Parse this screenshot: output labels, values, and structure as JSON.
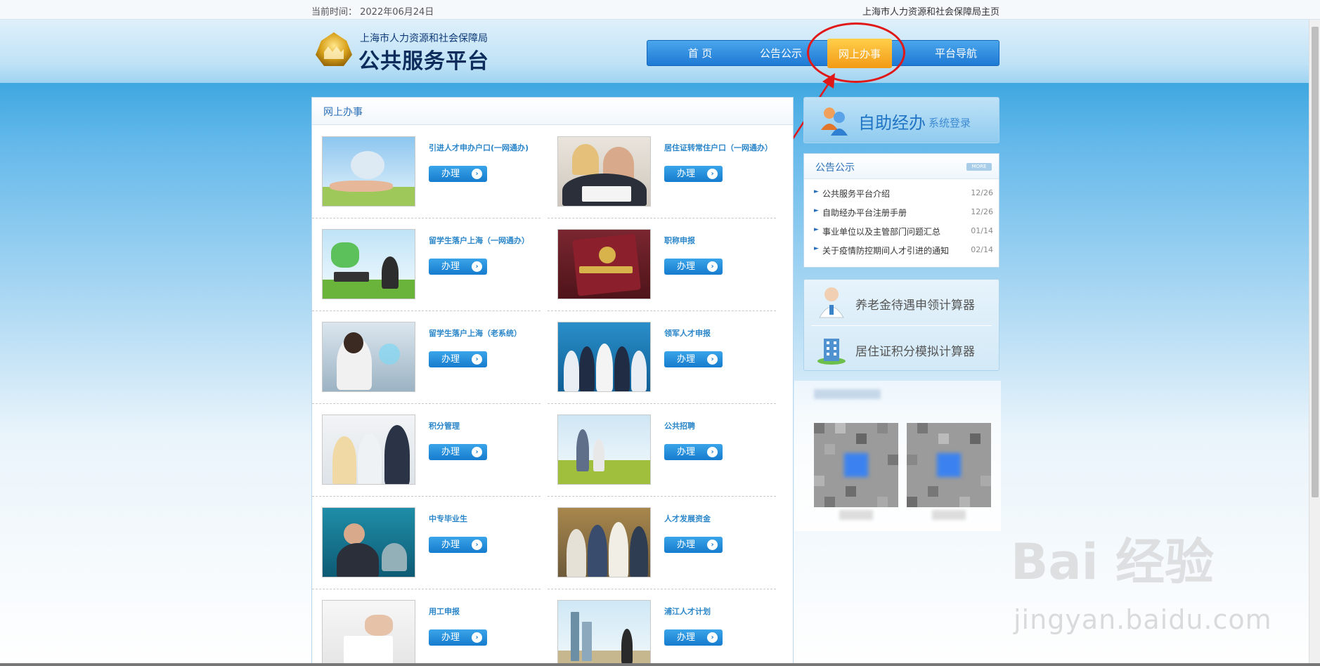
{
  "topbar": {
    "time": "当前时间： 2022年06月24日",
    "home_link": "上海市人力资源和社会保障局主页"
  },
  "header": {
    "logo_sub": "上海市人力资源和社会保障局",
    "logo_main": "公共服务平台",
    "nav": [
      {
        "label": "首  页",
        "active": false
      },
      {
        "label": "公告公示",
        "active": false
      },
      {
        "label": "网上办事",
        "active": true
      },
      {
        "label": "平台导航",
        "active": false
      }
    ]
  },
  "panel": {
    "title": "网上办事",
    "button_label": "办理",
    "items": [
      {
        "title": "引进人才申办户口(一网通办)",
        "thumb": "hand-house-image"
      },
      {
        "title": "居住证转常住户口（一网通办）",
        "thumb": "couple-photo-image"
      },
      {
        "title": "留学生落户上海（一网通办）",
        "thumb": "student-laptop-image"
      },
      {
        "title": "职称申报",
        "thumb": "household-booklet-image"
      },
      {
        "title": "留学生落户上海（老系统）",
        "thumb": "woman-touchscreen-image"
      },
      {
        "title": "领军人才申报",
        "thumb": "business-team-image"
      },
      {
        "title": "积分管理",
        "thumb": "office-workers-image"
      },
      {
        "title": "公共招聘",
        "thumb": "family-field-image"
      },
      {
        "title": "中专毕业生",
        "thumb": "graduate-image"
      },
      {
        "title": "人才发展资金",
        "thumb": "students-group-image"
      },
      {
        "title": "用工申报",
        "thumb": "writing-hand-image"
      },
      {
        "title": "浦江人才计划",
        "thumb": "city-skyline-image"
      }
    ]
  },
  "selfserve": {
    "big": "自助经办",
    "small": "系统登录"
  },
  "notice": {
    "title": "公告公示",
    "more": "MORE",
    "rows": [
      {
        "text": "公共服务平台介绍",
        "date": "12/26"
      },
      {
        "text": "自助经办平台注册手册",
        "date": "12/26"
      },
      {
        "text": "事业单位以及主管部门问题汇总",
        "date": "01/14"
      },
      {
        "text": "关于疫情防控期间人才引进的通知",
        "date": "02/14"
      }
    ]
  },
  "calculators": [
    {
      "label": "养老金待遇申领计算器",
      "icon": "doctor-icon"
    },
    {
      "label": "居住证积分模拟计算器",
      "icon": "building-icon"
    }
  ],
  "watermark": {
    "brand": "Bai 经验",
    "url": "jingyan.baidu.com"
  },
  "colors": {
    "nav_blue": "#1e79d4",
    "nav_active": "#f39a16",
    "link_blue": "#2a86c9",
    "annotation_red": "#e01818"
  }
}
